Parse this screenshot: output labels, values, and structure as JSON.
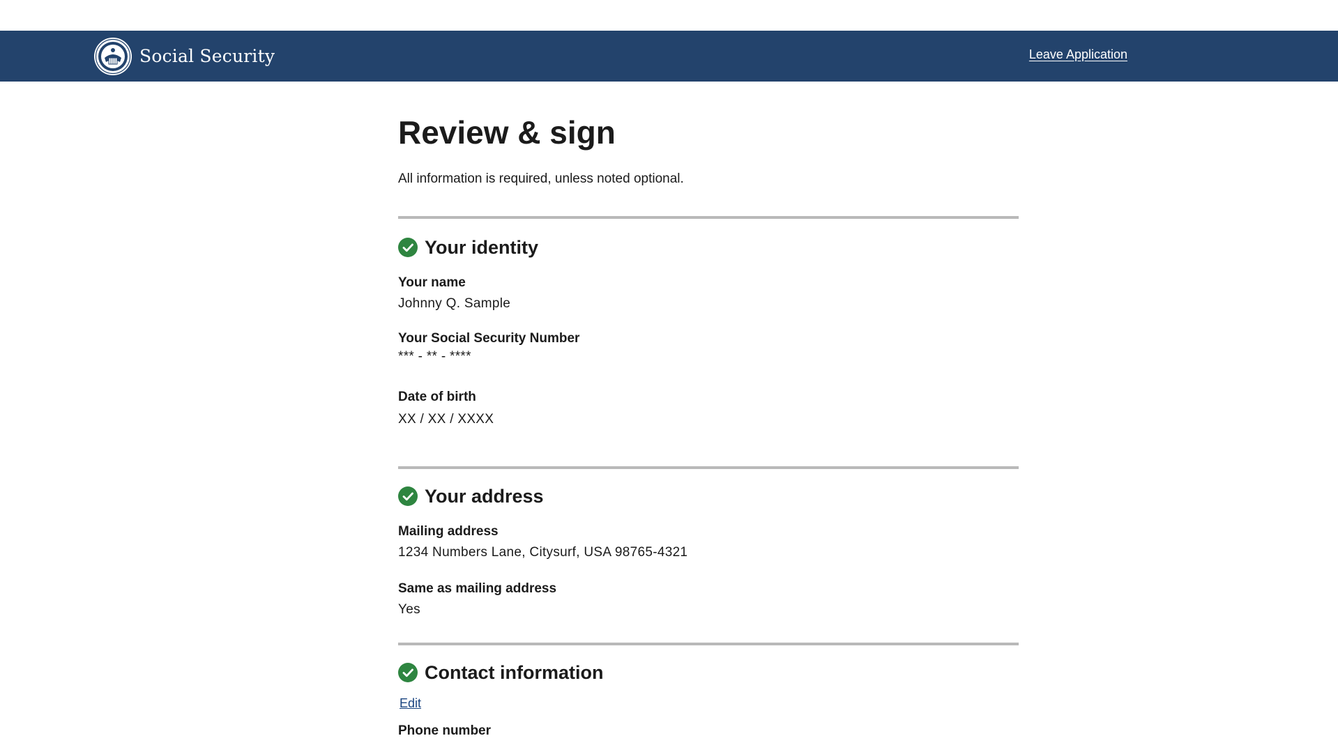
{
  "header": {
    "brand": "Social Security",
    "leave_label": "Leave Application",
    "bg_color": "#23436c"
  },
  "page": {
    "title": "Review & sign",
    "intro": "All information is required, unless noted optional."
  },
  "sections": {
    "identity": {
      "title": "Your identity",
      "status_icon": "check-circle-icon",
      "fields": [
        {
          "label": "Your name",
          "value": "Johnny Q. Sample"
        },
        {
          "label": "Your Social Security Number",
          "value": "*** - ** - ****"
        },
        {
          "label": "Date of birth",
          "value": "XX / XX / XXXX"
        }
      ]
    },
    "address": {
      "title": "Your address",
      "status_icon": "check-circle-icon",
      "fields": [
        {
          "label": "Mailing address",
          "value": "1234 Numbers Lane, Citysurf, USA 98765-4321"
        },
        {
          "label": "Same as mailing address",
          "value": "Yes"
        }
      ]
    },
    "contact": {
      "title": "Contact information",
      "status_icon": "check-circle-icon",
      "edit_label": "Edit",
      "fields": [
        {
          "label": "Phone number",
          "value": ""
        }
      ]
    }
  },
  "colors": {
    "check_green": "#2e8540",
    "link_blue": "#1a4480",
    "divider": "#b9b9b9"
  }
}
